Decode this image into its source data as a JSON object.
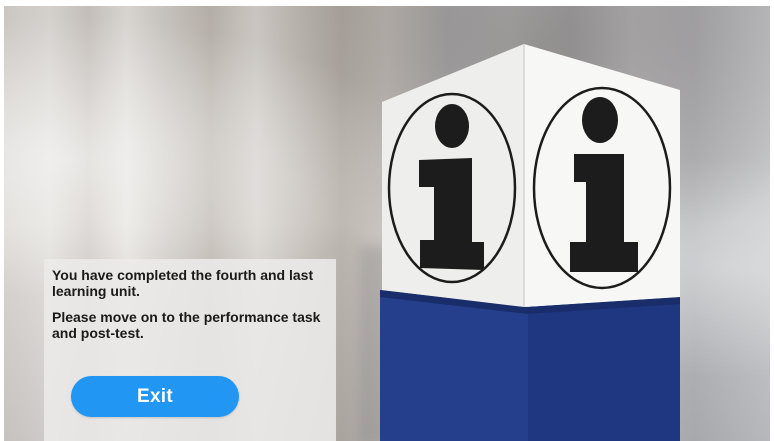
{
  "message": {
    "line1": "You have completed the fourth and last learning unit.",
    "line2": "Please move on to the performance task and post-test."
  },
  "actions": {
    "exit_label": "Exit"
  },
  "colors": {
    "exit_button": "#2196f3",
    "pillar_blue": "#253f8c",
    "sign_face": "#f2f2f2",
    "panel_bg": "#ecebe9"
  },
  "icons": {
    "sign_glyph": "info-icon"
  }
}
